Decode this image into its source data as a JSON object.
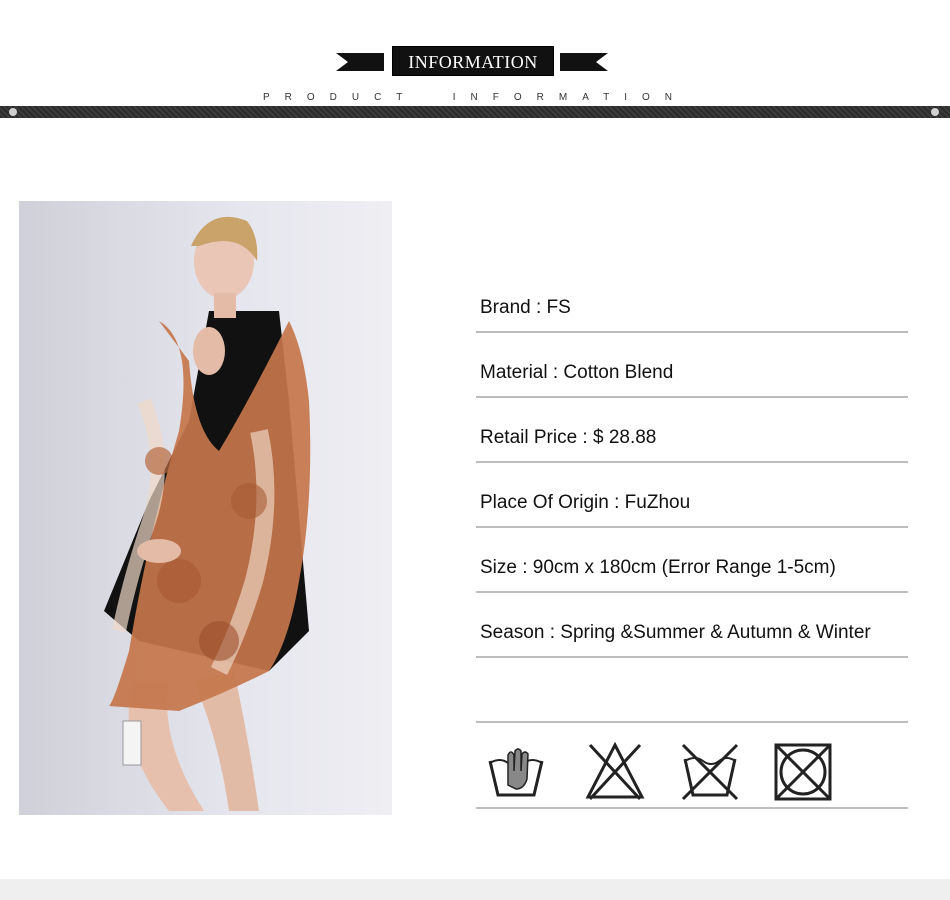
{
  "header": {
    "title": "INFORMATION",
    "subtitle": "PRODUCT  INFORMATION"
  },
  "product_image": {
    "alt": "Model wearing a rust-orange printed scarf over a black dress",
    "accent": "#b5643a"
  },
  "details": [
    {
      "text": "Brand : FS"
    },
    {
      "text": "Material :  Cotton Blend"
    },
    {
      "text": "Retail Price : $ 28.88"
    },
    {
      "text": "Place Of Origin : FuZhou"
    },
    {
      "text": "Size : 90cm x 180cm (Error Range 1-5cm)"
    },
    {
      "text": "Season : Spring &Summer & Autumn & Winter"
    }
  ],
  "care_icons": [
    "hand-wash-icon",
    "no-bleach-icon",
    "no-tumble-dry-icon",
    "no-dry-clean-icon"
  ]
}
